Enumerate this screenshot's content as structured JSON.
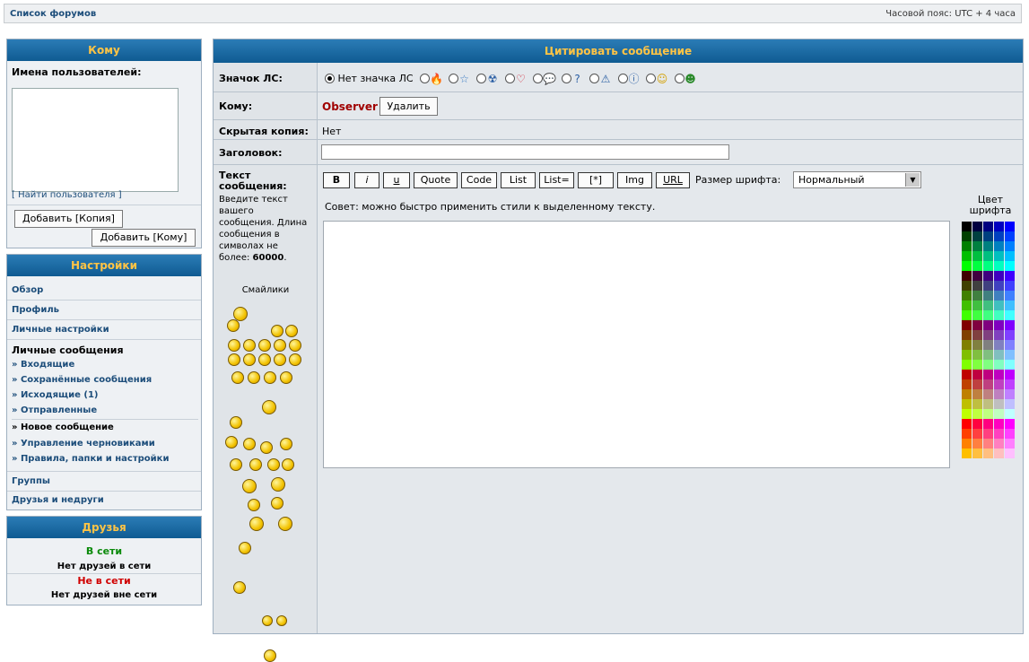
{
  "topbar": {
    "home": "Список форумов",
    "timezone": "Часовой пояс: UTC + 4 часа"
  },
  "to_panel": {
    "title": "Кому",
    "usernames_label": "Имена пользователей:",
    "find_link": "[ Найти пользователя ]",
    "add_copy": "Добавить [Копия]",
    "add_to": "Добавить [Кому]"
  },
  "settings": {
    "title": "Настройки",
    "items": [
      "Обзор",
      "Профиль",
      "Личные настройки"
    ],
    "pm_header": "Личные сообщения",
    "pm_items": [
      "» Входящие",
      "» Сохранённые сообщения",
      "» Исходящие (1)",
      "» Отправленные",
      "» Новое сообщение",
      "» Управление черновиками",
      "» Правила, папки и настройки"
    ],
    "bottom_items": [
      "Группы",
      "Друзья и недруги"
    ]
  },
  "friends": {
    "title": "Друзья",
    "online": "В сети",
    "none_online": "Нет друзей в сети",
    "offline": "Не в сети",
    "none_offline": "Нет друзей вне сети"
  },
  "form": {
    "title": "Цитировать сообщение",
    "icon_label": "Значок ЛС:",
    "no_icon": "Нет значка ЛС",
    "icons": [
      "fire-icon",
      "star-icon",
      "radioactive-icon",
      "heart-icon",
      "speech-bubble-icon",
      "question-icon",
      "warning-icon",
      "info-icon",
      "smiley-icon",
      "grin-icon"
    ],
    "to_label": "Кому:",
    "recipient": "Observer",
    "delete": "Удалить",
    "bcc_label": "Скрытая копия:",
    "bcc_value": "Нет",
    "subject_label": "Заголовок:",
    "text_label": "Текст сообщения:",
    "text_hint": "Введите текст вашего сообщения. Длина сообщения в символах не более:",
    "text_limit": "60000",
    "smilies_label": "Смайлики",
    "buttons": {
      "b": "B",
      "i": "i",
      "u": "u",
      "quote": "Quote",
      "code": "Code",
      "list": "List",
      "list_eq": "List=",
      "star": "[*]",
      "img": "Img",
      "url": "URL"
    },
    "font_size_label": "Размер шрифта:",
    "font_size_value": "Нормальный",
    "tip": "Совет: можно быстро применить стили к выделенному тексту.",
    "font_color_label": "Цвет шрифта"
  },
  "colors": {
    "accent": "#0f5b92",
    "header_text": "#ffc445",
    "recipient": "#a00000"
  }
}
